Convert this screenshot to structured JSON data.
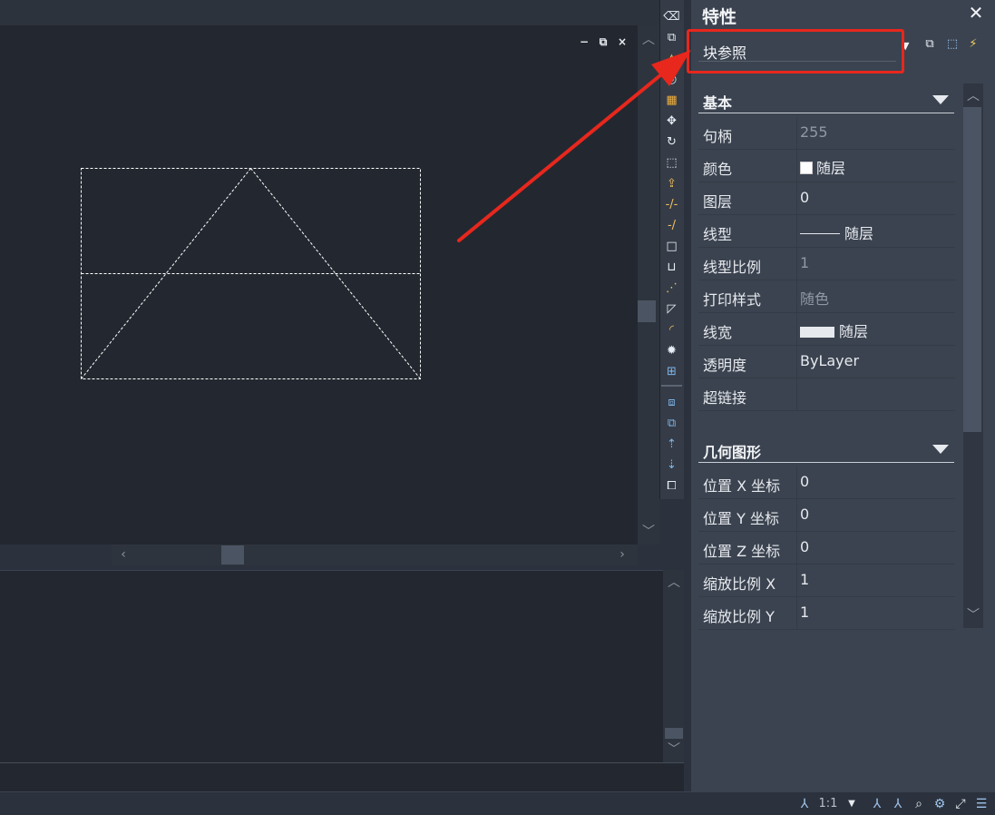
{
  "panel": {
    "title": "特性",
    "close": "✕",
    "selected_object": "块参照",
    "sections": [
      {
        "title": "基本",
        "rows": [
          {
            "label": "句柄",
            "value": "255",
            "dim": true
          },
          {
            "label": "颜色",
            "value": "随层",
            "swatch": "color"
          },
          {
            "label": "图层",
            "value": "0"
          },
          {
            "label": "线型",
            "value": "随层",
            "swatch": "line"
          },
          {
            "label": "线型比例",
            "value": "1",
            "dim": true
          },
          {
            "label": "打印样式",
            "value": "随色",
            "dim": true
          },
          {
            "label": "线宽",
            "value": "随层",
            "swatch": "lineweight"
          },
          {
            "label": "透明度",
            "value": "ByLayer"
          },
          {
            "label": "超链接",
            "value": ""
          }
        ]
      },
      {
        "title": "几何图形",
        "rows": [
          {
            "label": "位置 X 坐标",
            "value": "0"
          },
          {
            "label": "位置 Y 坐标",
            "value": "0"
          },
          {
            "label": "位置 Z 坐标",
            "value": "0"
          },
          {
            "label": "缩放比例 X",
            "value": "1"
          },
          {
            "label": "缩放比例 Y",
            "value": "1"
          }
        ]
      }
    ]
  },
  "window_controls": {
    "minimize": "−",
    "restore": "⧉",
    "close": "×"
  },
  "statusbar": {
    "annotation_scale": "1:1"
  },
  "colors": {
    "canvas_bg": "#232830",
    "panel_bg": "#3b4350",
    "highlight": "#e8271d",
    "arrow": "#e8271d",
    "dashed_geometry": "#ffffff"
  }
}
